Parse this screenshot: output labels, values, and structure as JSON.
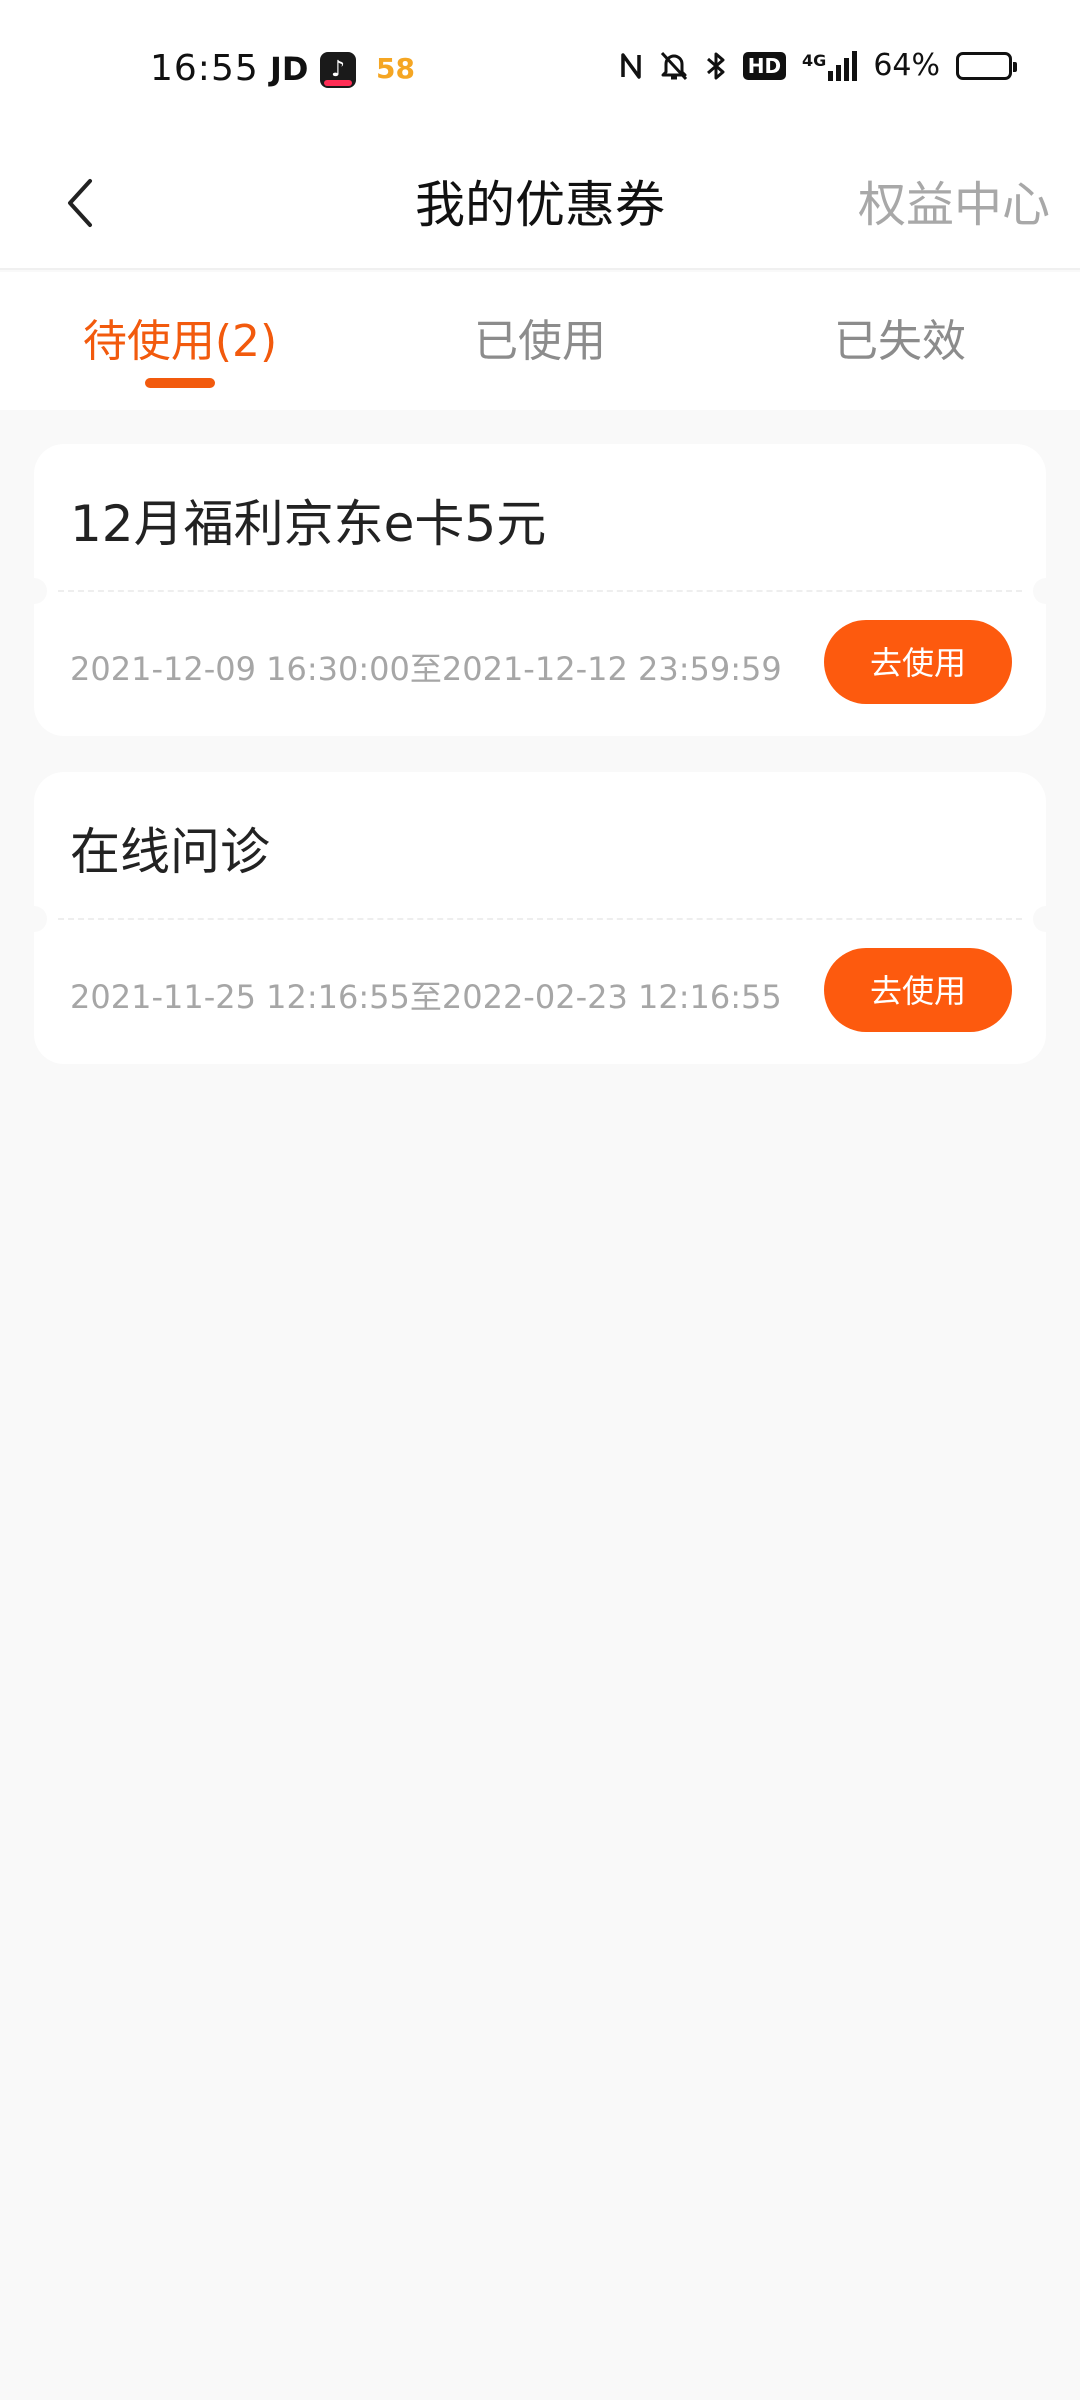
{
  "status_bar": {
    "time": "16:55",
    "apps": [
      "JD",
      "tiktok-icon",
      "58"
    ],
    "app_jd_label": "JD",
    "app_58_label": "58",
    "network": "4G",
    "hd_label": "HD",
    "battery_text": "64%",
    "battery_level": 0.64,
    "icons": [
      "nfc-icon",
      "bell-muted-icon",
      "bluetooth-icon",
      "hd-voice-icon",
      "signal-icon",
      "battery-icon"
    ]
  },
  "header": {
    "title": "我的优惠券",
    "right_link": "权益中心",
    "back_icon": "chevron-left-icon"
  },
  "tabs": [
    {
      "label": "待使用(2)",
      "active": true
    },
    {
      "label": "已使用",
      "active": false
    },
    {
      "label": "已失效",
      "active": false
    }
  ],
  "coupons": [
    {
      "name": "12月福利京东e卡5元",
      "validity": "2021-12-09 16:30:00至2021-12-12 23:59:59",
      "button": "去使用"
    },
    {
      "name": "在线问诊",
      "validity": "2021-11-25 12:16:55至2022-02-23 12:16:55",
      "button": "去使用"
    }
  ],
  "colors": {
    "accent": "#f25a0d",
    "button": "#fd5a0e",
    "page_bg": "#f9f9f9",
    "muted_text": "#a6a6a6"
  }
}
